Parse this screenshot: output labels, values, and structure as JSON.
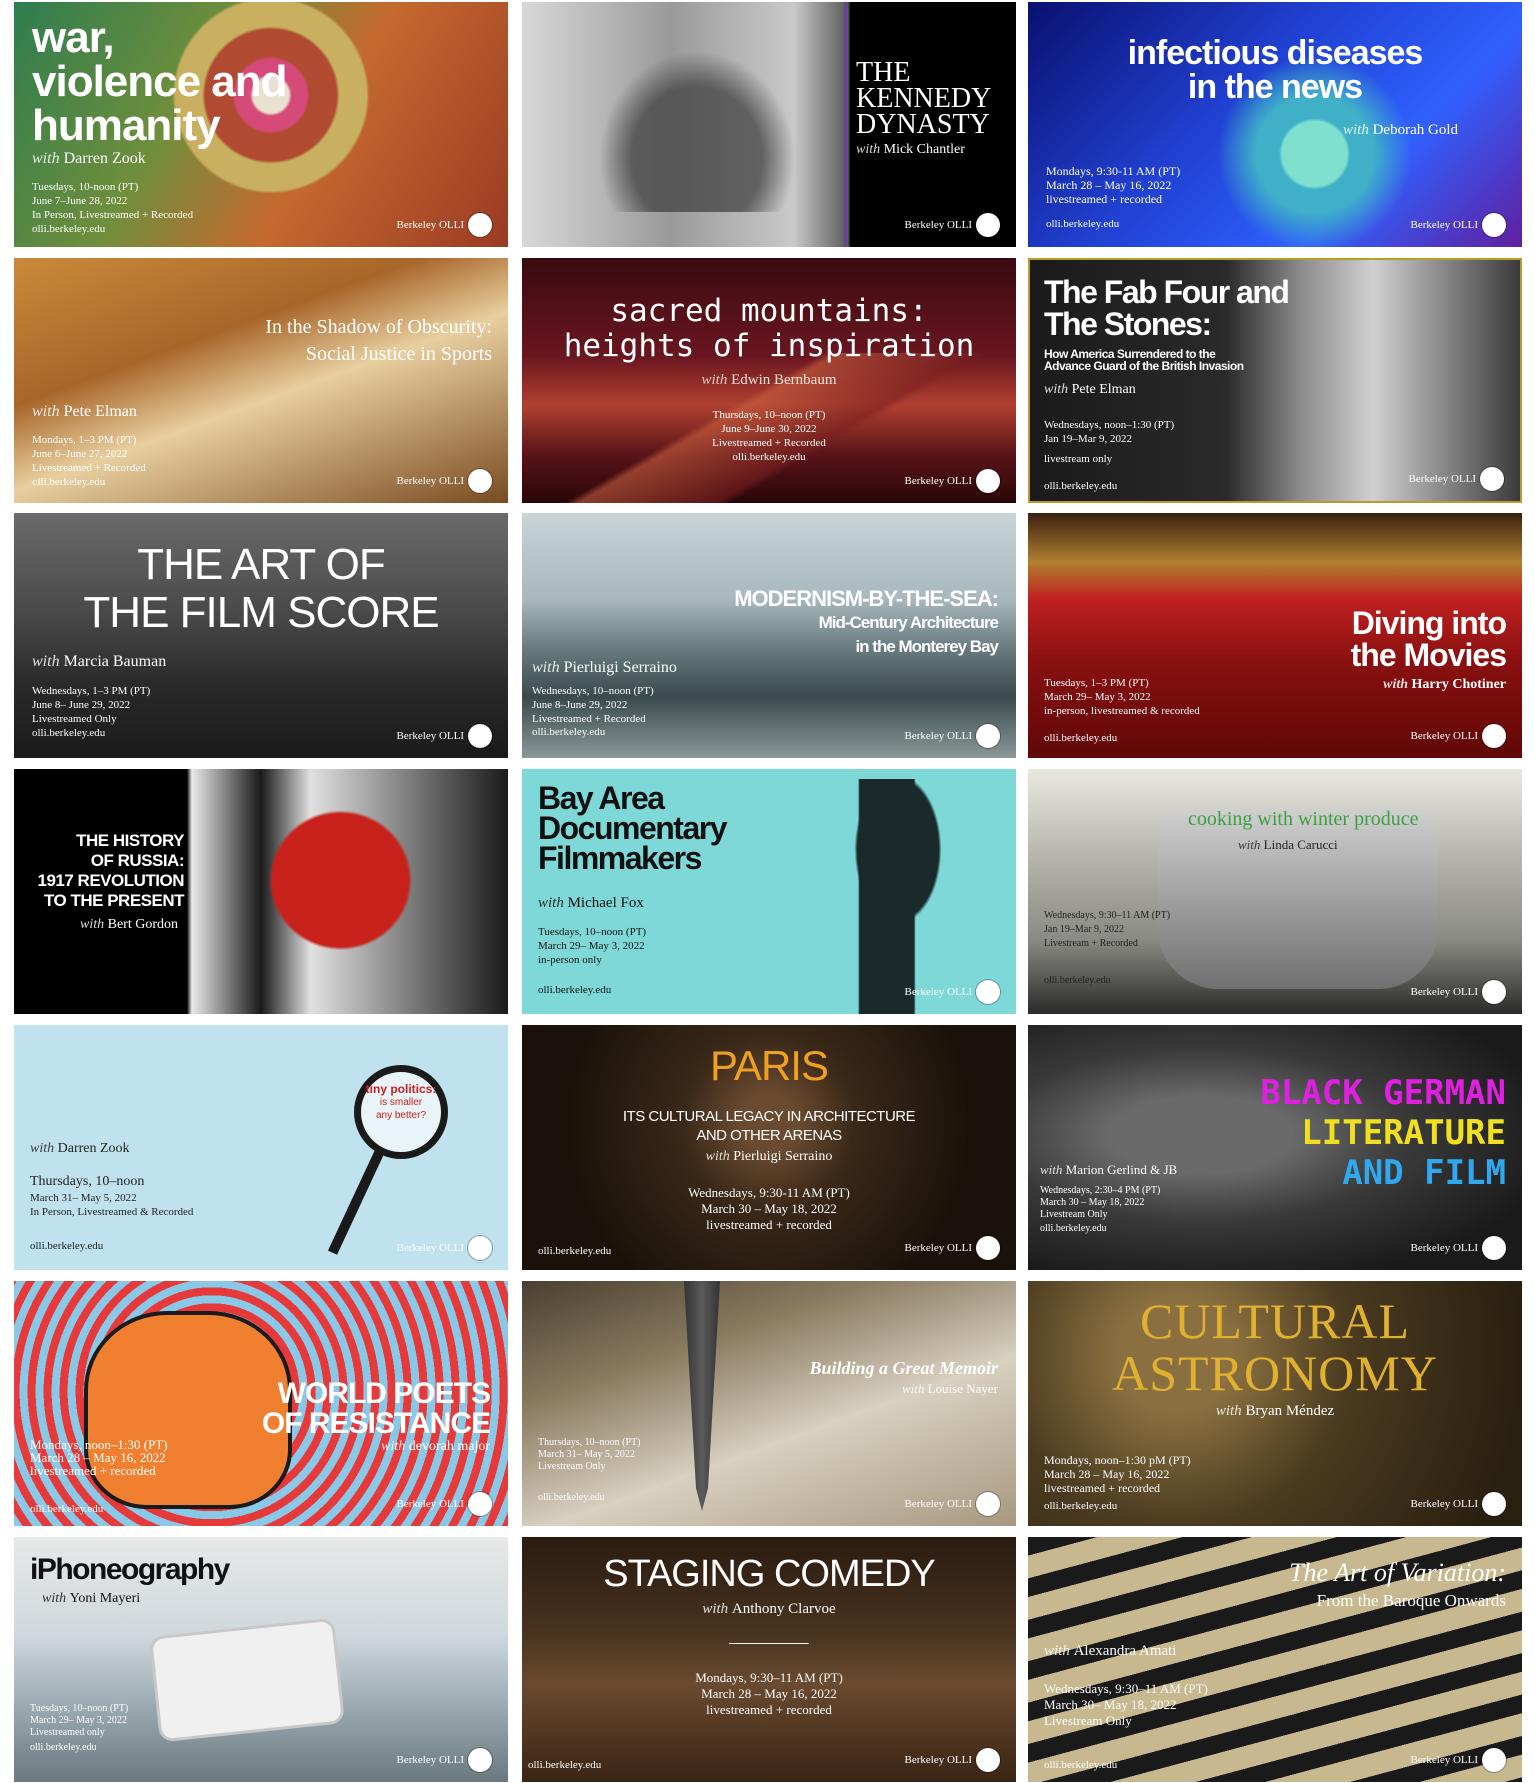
{
  "brand_label": "Berkeley OLLI",
  "cards": [
    {
      "title_lines": [
        "war,",
        "violence and",
        "humanity"
      ],
      "instructor": "Darren Zook",
      "schedule": [
        "Tuesdays, 10-noon (PT)",
        "June 7–June 28, 2022",
        "In Person, Livestreamed + Recorded"
      ],
      "site": "olli.berkeley.edu"
    },
    {
      "title_lines": [
        "THE",
        "KENNEDY",
        "DYNASTY"
      ],
      "instructor": "Mick Chantler",
      "schedule": [],
      "site": ""
    },
    {
      "title_lines": [
        "infectious diseases",
        "in the news"
      ],
      "instructor": "Deborah Gold",
      "schedule": [
        "Mondays, 9:30-11 AM (PT)",
        "March 28 – May 16, 2022",
        "livestreamed + recorded"
      ],
      "site": "olli.berkeley.edu"
    },
    {
      "title_lines": [
        "In the Shadow of Obscurity:",
        "Social Justice in Sports"
      ],
      "instructor": "Pete Elman",
      "schedule": [
        "Mondays, 1–3 PM (PT)",
        "June 6–June 27, 2022",
        "Livestreamed + Recorded"
      ],
      "site": "olli.berkeley.edu"
    },
    {
      "title_lines": [
        "sacred mountains:",
        "heights of inspiration"
      ],
      "instructor": "Edwin Bernbaum",
      "schedule": [
        "Thursdays, 10–noon (PT)",
        "June 9–June 30, 2022",
        "Livestreamed + Recorded"
      ],
      "site": "olli.berkeley.edu"
    },
    {
      "title_lines": [
        "The Fab Four and",
        "The Stones:"
      ],
      "subtitle_lines": [
        "How America Surrendered to the",
        "Advance Guard of the British Invasion"
      ],
      "instructor": "Pete Elman",
      "schedule": [
        "Wednesdays, noon–1:30 (PT)",
        "Jan 19–Mar 9, 2022",
        "livestream only"
      ],
      "site": "olli.berkeley.edu"
    },
    {
      "title_lines": [
        "THE ART OF",
        "THE FILM SCORE"
      ],
      "instructor": "Marcia Bauman",
      "schedule": [
        "Wednesdays, 1–3 PM (PT)",
        "June 8– June 29, 2022",
        "Livestreamed Only"
      ],
      "site": "olli.berkeley.edu"
    },
    {
      "title_lines": [
        "MODERNISM-BY-THE-SEA:",
        "Mid-Century Architecture",
        "in the Monterey Bay"
      ],
      "instructor": "Pierluigi Serraino",
      "schedule": [
        "Wednesdays, 10–noon (PT)",
        "June 8–June 29, 2022",
        "Livestreamed + Recorded"
      ],
      "site": "olli.berkeley.edu"
    },
    {
      "title_lines": [
        "Diving into",
        "the Movies"
      ],
      "instructor": "Harry Chotiner",
      "schedule": [
        "Tuesdays, 1–3 PM (PT)",
        "March 29– May 3, 2022",
        "in-person, livestreamed & recorded"
      ],
      "site": "olli.berkeley.edu"
    },
    {
      "title_lines": [
        "THE HISTORY",
        "OF RUSSIA:",
        "1917 REVOLUTION",
        "TO THE PRESENT"
      ],
      "instructor": "Bert Gordon",
      "schedule": [],
      "site": ""
    },
    {
      "title_lines": [
        "Bay Area",
        "Documentary",
        "Filmmakers"
      ],
      "instructor": "Michael Fox",
      "schedule": [
        "Tuesdays, 10–noon (PT)",
        "March 29– May 3, 2022",
        "in-person only"
      ],
      "site": "olli.berkeley.edu"
    },
    {
      "title_lines": [
        "cooking with winter produce"
      ],
      "instructor": "Linda Carucci",
      "schedule": [
        "Wednesdays, 9:30–11 AM (PT)",
        "Jan 19–Mar 9, 2022",
        "",
        "Livestream + Recorded"
      ],
      "site": "olli.berkeley.edu"
    },
    {
      "title_lines": [
        "tiny politics:",
        "is smaller",
        "any better?"
      ],
      "instructor": "Darren Zook",
      "schedule": [
        "Thursdays, 10–noon",
        "March 31– May 5, 2022",
        "In Person, Livestreamed & Recorded"
      ],
      "site": "olli.berkeley.edu"
    },
    {
      "title_lines": [
        "PARIS",
        "ITS CULTURAL LEGACY IN ARCHITECTURE",
        "AND OTHER ARENAS"
      ],
      "instructor": "Pierluigi Serraino",
      "schedule": [
        "Wednesdays, 9:30-11 AM (PT)",
        "March 30 – May 18, 2022",
        "livestreamed + recorded"
      ],
      "site": "olli.berkeley.edu"
    },
    {
      "title_lines": [
        "BLACK GERMAN",
        "LITERATURE",
        "AND FILM"
      ],
      "instructor": "Marion Gerlind & JB",
      "schedule": [
        "Wednesdays, 2:30–4 PM (PT)",
        "March 30 – May 18, 2022",
        "Livestream Only"
      ],
      "site": "olli.berkeley.edu"
    },
    {
      "title_lines": [
        "WORLD POETS",
        "OF RESISTANCE"
      ],
      "instructor": "devorah major",
      "schedule": [
        "Mondays, noon–1:30 (PT)",
        "March 28 – May 16, 2022",
        "livestreamed + recorded"
      ],
      "site": "olli.berkeley.edu"
    },
    {
      "title_lines": [
        "Building a Great Memoir"
      ],
      "instructor": "Louise Nayer",
      "schedule": [
        "Thursdays, 10–noon (PT)",
        "March 31– May 5, 2022",
        "Livestream Only"
      ],
      "site": "olli.berkeley.edu"
    },
    {
      "title_lines": [
        "CULTURAL",
        "ASTRONOMY"
      ],
      "instructor": "Bryan Méndez",
      "schedule": [
        "Mondays, noon–1:30 pM (PT)",
        "March 28 – May 16, 2022",
        "livestreamed + recorded"
      ],
      "site": "olli.berkeley.edu"
    },
    {
      "title_lines": [
        "iPhoneography"
      ],
      "instructor": "Yoni Mayeri",
      "schedule": [
        "Tuesdays, 10–noon (PT)",
        "March 29– May 3, 2022",
        "Livestreamed only"
      ],
      "site": "olli.berkeley.edu"
    },
    {
      "title_lines": [
        "STAGING COMEDY"
      ],
      "instructor": "Anthony Clarvoe",
      "schedule": [
        "Mondays, 9:30–11 AM (PT)",
        "March 28 – May 16, 2022",
        "livestreamed + recorded"
      ],
      "site": "olli.berkeley.edu"
    },
    {
      "title_lines": [
        "The Art of Variation:",
        "From the Baroque Onwards"
      ],
      "instructor": "Alexandra Amati",
      "schedule": [
        "Wednesdays, 9:30–11 AM (PT)",
        "March 30– May 18, 2022",
        "Livestream Only"
      ],
      "site": "olli.berkeley.edu"
    }
  ]
}
